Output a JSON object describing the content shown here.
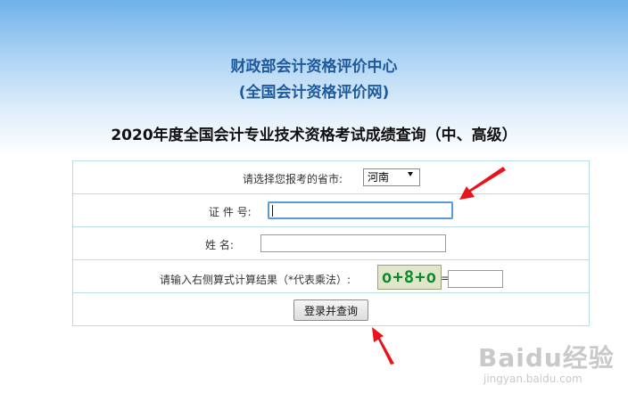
{
  "header": {
    "title_line1": "财政部会计资格评价中心",
    "title_line2": "(全国会计资格评价网)"
  },
  "exam_title": "2020年度全国会计专业技术资格考试成绩查询（中、高级）",
  "form": {
    "province_label": "请选择您报考的省市:",
    "province_selected": "河南",
    "id_label": "证 件 号:",
    "id_value": "",
    "name_label": "姓  名:",
    "name_value": "",
    "captcha_label": "请输入右侧算式计算结果（*代表乘法）:",
    "captcha_image_text": "o+8+o",
    "captcha_equals": "=",
    "captcha_value": "",
    "submit_label": "登录并查询"
  },
  "annotations": {
    "arrow_color": "#e8141c"
  },
  "watermark": {
    "main": "Baidu经验",
    "sub": "jingyan.baidu.com"
  }
}
